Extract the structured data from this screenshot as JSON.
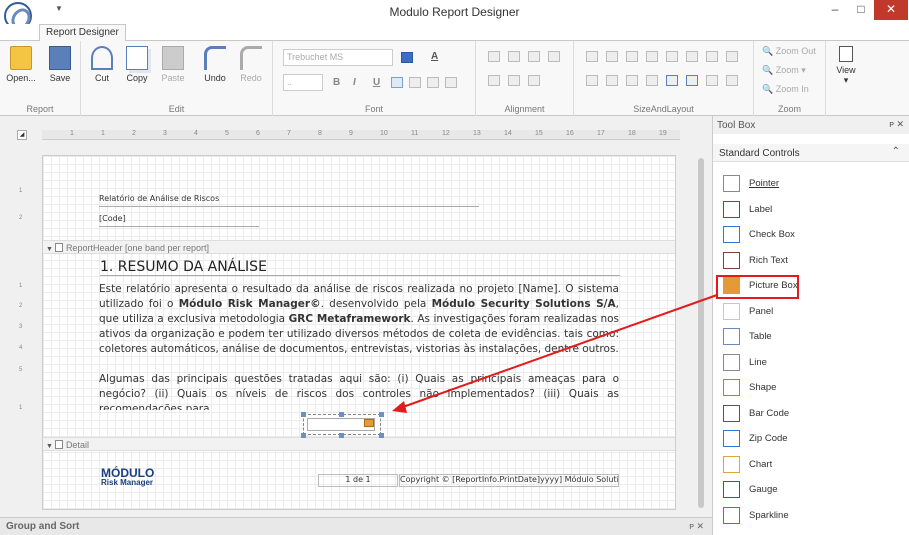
{
  "window": {
    "title": "Modulo Report Designer",
    "min": "–",
    "max": "□",
    "close": "✕"
  },
  "tabs": [
    {
      "label": "Report Designer"
    }
  ],
  "ribbon": {
    "report": {
      "label": "Report",
      "open": "Open...",
      "save": "Save"
    },
    "edit": {
      "label": "Edit",
      "cut": "Cut",
      "copy": "Copy",
      "paste": "Paste",
      "undo": "Undo",
      "redo": "Redo"
    },
    "font": {
      "label": "Font",
      "family": "Trebuchet MS",
      "size": "..",
      "bold": "B",
      "italic": "I",
      "underline": "U"
    },
    "alignment": {
      "label": "Alignment"
    },
    "sizeandlayout": {
      "label": "SizeAndLayout"
    },
    "zoom": {
      "label": "Zoom",
      "zoom_out": "Zoom Out",
      "zoom": "Zoom",
      "zoom_in": "Zoom In"
    },
    "view": {
      "label": "View"
    }
  },
  "ruler": [
    "1",
    "1",
    "2",
    "3",
    "4",
    "5",
    "6",
    "7",
    "8",
    "9",
    "10",
    "11",
    "12",
    "13",
    "14",
    "15",
    "16",
    "17",
    "18",
    "19"
  ],
  "vruler": [
    "1",
    "2",
    "1",
    "2",
    "3",
    "4",
    "5",
    "1"
  ],
  "report": {
    "header_title": "Relatório de Análise de Riscos",
    "code_field": "[Code]",
    "band_reportheader": "ReportHeader [one band per report]",
    "section_title": "1. RESUMO DA ANÁLISE",
    "p1_a": "Este relatório apresenta o resultado da análise de riscos realizada no projeto [Name]. O sistema utilizado foi o ",
    "p1_b": "Módulo Risk Manager©",
    "p1_c": ". desenvolvido pela ",
    "p1_d": "Módulo Security Solutions S/A",
    "p1_e": ", que utiliza a exclusiva metodologia ",
    "p1_f": "GRC Metaframework",
    "p1_g": ". As investigações foram realizadas nos ativos da organização e podem ter utilizado diversos métodos de coleta de evidências. tais como: coletores automáticos, análise de documentos, entrevistas, vistorias às instalações, dentre outros.",
    "p2": "Algumas das principais questões tratadas aqui são: (i) Quais as principais ameaças para o negócio? (ii) Quais os níveis de riscos dos controles não implementados? (iii) Quais as recomendações para",
    "band_detail": "Detail",
    "footer_logo_1": "MÓDULO",
    "footer_logo_2": "Risk Manager",
    "page_num": "1 de 1",
    "copyright": "Copyright © [ReportInfo.PrintDate]yyyy] Módulo Soluti"
  },
  "toolbox": {
    "title": "Tool Box",
    "pin": "ᴘ ✕",
    "category": "Standard Controls",
    "items": [
      "Pointer",
      "Label",
      "Check Box",
      "Rich Text",
      "Picture Box",
      "Panel",
      "Table",
      "Line",
      "Shape",
      "Bar Code",
      "Zip Code",
      "Chart",
      "Gauge",
      "Sparkline"
    ]
  },
  "statusbar": {
    "label": "Group and Sort",
    "icons": "ᴘ ✕"
  }
}
